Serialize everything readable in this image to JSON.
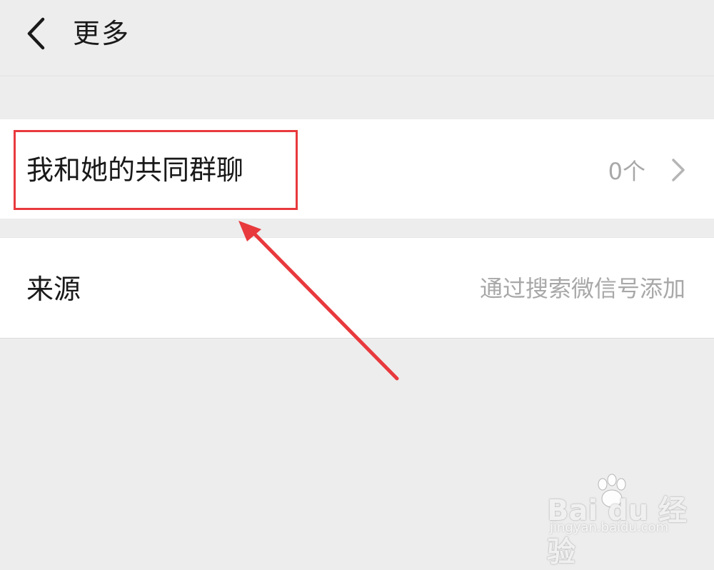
{
  "header": {
    "back_icon": "chevron-left-icon",
    "title": "更多"
  },
  "rows": [
    {
      "label": "我和她的共同群聊",
      "value": "0个",
      "icon": "chevron-right-icon"
    },
    {
      "label": "来源",
      "value": "通过搜索微信号添加"
    }
  ],
  "annotation": {
    "color": "#e8393d",
    "highlight": "red-box",
    "arrow": "red-arrow"
  },
  "watermark": {
    "main": "Bai du 经验",
    "sub": "jingyan.baidu.com"
  }
}
